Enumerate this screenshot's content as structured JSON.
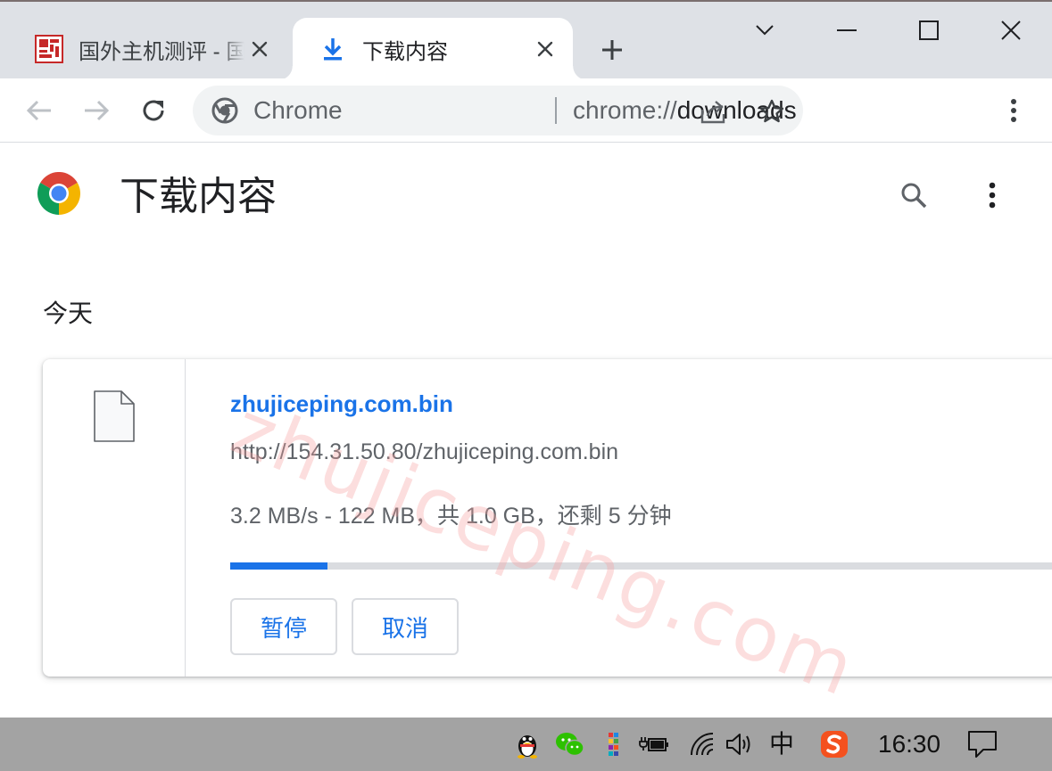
{
  "browser": {
    "tabs": [
      {
        "title": "国外主机测评 - 国",
        "favicon": "site-seal-icon",
        "active": false
      },
      {
        "title": "下载内容",
        "favicon": "download-icon",
        "active": true
      }
    ],
    "new_tab_icon": "plus-icon",
    "window_controls": [
      "chevron-down-icon",
      "minimize-icon",
      "maximize-icon",
      "close-icon"
    ]
  },
  "toolbar": {
    "back_icon": "back-arrow-icon",
    "forward_icon": "forward-arrow-icon",
    "reload_icon": "reload-icon",
    "omnibox": {
      "chip_label": "Chrome",
      "url_scheme": "chrome://",
      "url_path": "downloads"
    },
    "menu_icon": "kebab-menu-icon"
  },
  "downloads_page": {
    "title": "下载内容",
    "watermark": "zhujiceping.com",
    "date_group": "今天",
    "items": [
      {
        "file_name": "zhujiceping.com.bin",
        "source_url": "http://154.31.50.80/zhujiceping.com.bin",
        "status": "3.2 MB/s - 122 MB，共 1.0 GB，还剩 5 分钟",
        "progress_fraction": 0.115,
        "pause_label": "暂停",
        "cancel_label": "取消"
      }
    ]
  },
  "taskbar": {
    "ime_label": "中",
    "clock": "16:30"
  },
  "colors": {
    "accent": "#1a73e8",
    "tab_strip": "#dee1e6",
    "taskbar": "#a3a3a3",
    "watermark": "#f6a0a0"
  }
}
